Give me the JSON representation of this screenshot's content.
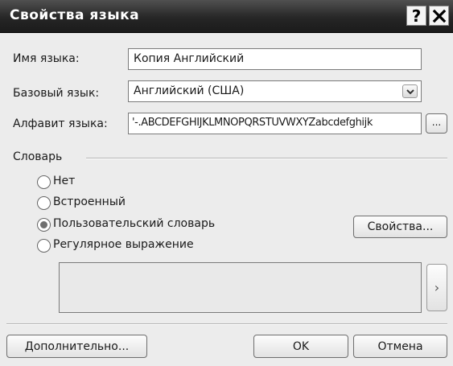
{
  "window": {
    "title": "Свойства языка",
    "help_glyph": "?",
    "close_glyph": "✕"
  },
  "fields": {
    "name_label": "Имя языка:",
    "name_value": "Копия Английский",
    "base_label": "Базовый язык:",
    "base_value": "Английский (США)",
    "alphabet_label": "Алфавит языка:",
    "alphabet_value": "'-.ABCDEFGHIJKLMNOPQRSTUVWXYZabcdefghijk",
    "alphabet_button": "..."
  },
  "dictionary": {
    "group_label": "Словарь",
    "options": [
      {
        "label": "Нет",
        "checked": false
      },
      {
        "label": "Встроенный",
        "checked": false
      },
      {
        "label": "Пользовательский словарь",
        "checked": true
      },
      {
        "label": "Регулярное выражение",
        "checked": false
      }
    ],
    "properties_button": "Свойства...",
    "side_button_glyph": "›"
  },
  "footer": {
    "advanced_button": "Дополнительно...",
    "ok_button": "OK",
    "cancel_button": "Отмена"
  }
}
